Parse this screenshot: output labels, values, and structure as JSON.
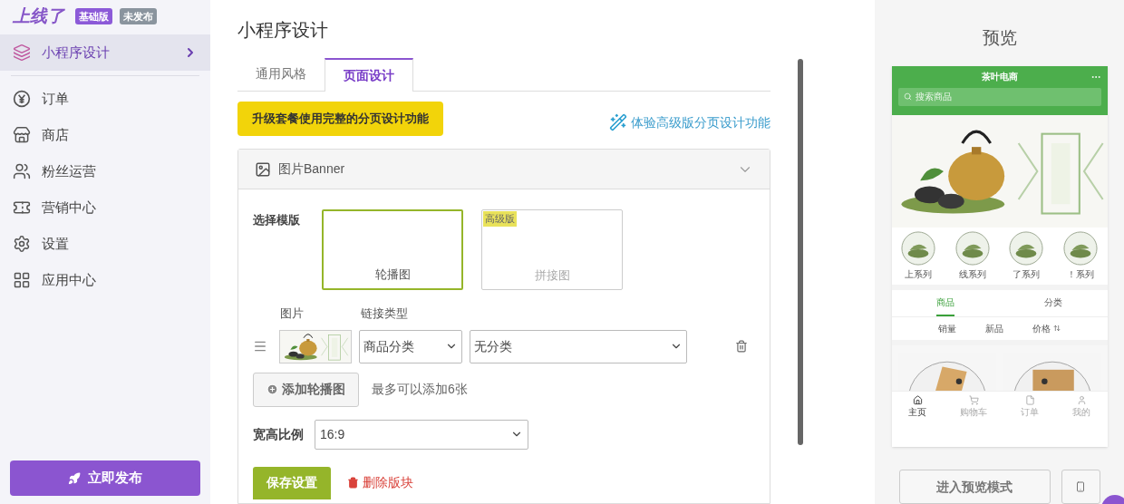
{
  "brand": {
    "logo": "上线了",
    "badges": [
      {
        "text": "基础版",
        "color": "#8c5ad8"
      },
      {
        "text": "未发布",
        "color": "#8a949e"
      }
    ]
  },
  "sidebar": {
    "items": [
      {
        "label": "小程序设计",
        "selected": true
      },
      {
        "label": "订单",
        "selected": false
      },
      {
        "label": "商店",
        "selected": false
      },
      {
        "label": "粉丝运营",
        "selected": false
      },
      {
        "label": "营销中心",
        "selected": false
      },
      {
        "label": "设置",
        "selected": false
      },
      {
        "label": "应用中心",
        "selected": false
      }
    ],
    "publish_button": "立即发布"
  },
  "page_title": "小程序设计",
  "tabs": [
    {
      "label": "通用风格",
      "selected": false
    },
    {
      "label": "页面设计",
      "selected": true
    }
  ],
  "upgrade_button": "升级套餐使用完整的分页设计功能",
  "trial_link": "体验高级版分页设计功能",
  "panel": {
    "title": "图片Banner",
    "template_label": "选择模版",
    "templates": [
      {
        "label": "轮播图",
        "selected": true
      },
      {
        "label": "拼接图",
        "selected": false,
        "badge": "高级版"
      }
    ],
    "columns": [
      "图片",
      "链接类型"
    ],
    "rows": [
      {
        "link_type": "商品分类",
        "category": "无分类"
      }
    ],
    "add_button": "添加轮播图",
    "add_hint": "最多可以添加6张",
    "ratio_label": "宽高比例",
    "ratio_value": "16:9",
    "save_button": "保存设置",
    "delete_link": "删除版块"
  },
  "preview": {
    "title": "预览",
    "phone": {
      "title": "茶叶电商",
      "search_placeholder": "搜索商品",
      "categories": [
        "上系列",
        "线系列",
        "了系列",
        "！系列"
      ],
      "tabs": [
        {
          "label": "商品",
          "selected": true
        },
        {
          "label": "分类",
          "selected": false
        }
      ],
      "sorts": [
        {
          "label": "销量",
          "sortable": false
        },
        {
          "label": "新品",
          "sortable": false
        },
        {
          "label": "价格",
          "sortable": true
        }
      ],
      "nav": [
        {
          "label": "主页",
          "selected": true
        },
        {
          "label": "购物车",
          "selected": false
        },
        {
          "label": "订单",
          "selected": false
        },
        {
          "label": "我的",
          "selected": false
        }
      ]
    },
    "preview_button": "进入预览模式"
  }
}
